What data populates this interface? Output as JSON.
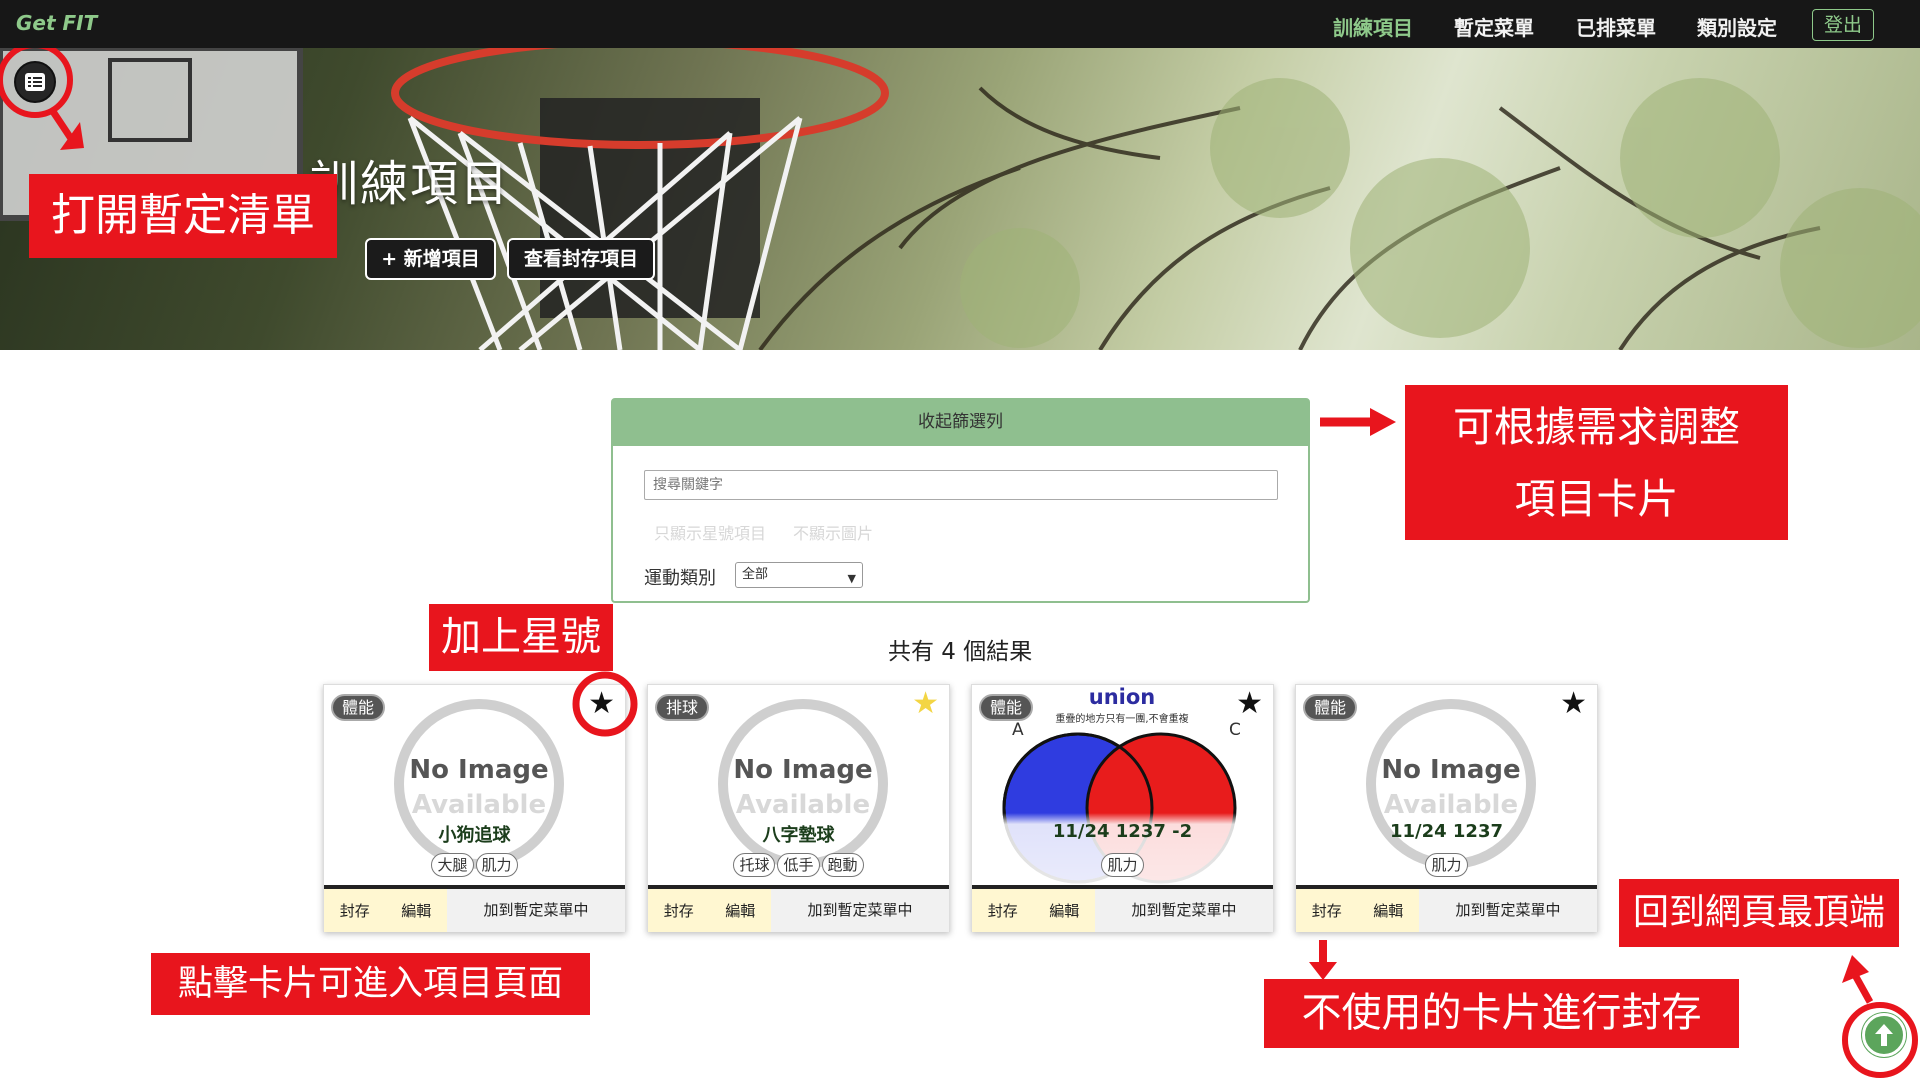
{
  "navbar": {
    "brand": "Get FIT",
    "links": [
      "訓練項目",
      "暫定菜單",
      "已排菜單",
      "類別設定"
    ],
    "logout": "登出"
  },
  "hero": {
    "title": "訓練項目",
    "add_button": "+ 新增項目",
    "archive_button": "查看封存項目"
  },
  "filter": {
    "header": "收起篩選列",
    "search_placeholder": "搜尋關鍵字",
    "option_starred": "只顯示星號項目",
    "option_no_image": "不顯示圖片",
    "category_label": "運動類別",
    "category_value": "全部"
  },
  "results": "共有 4 個結果",
  "cards": [
    {
      "badge": "體能",
      "title": "小狗追球",
      "tags": [
        "大腿",
        "肌力"
      ],
      "starred": true,
      "image_text_1": "No Image",
      "image_text_2": "Available"
    },
    {
      "badge": "排球",
      "title": "八字墊球",
      "tags": [
        "托球",
        "低手",
        "跑動"
      ],
      "starred": false,
      "image_text_1": "No Image",
      "image_text_2": "Available"
    },
    {
      "badge": "體能",
      "title": "11/24 1237 -2",
      "tags": [
        "肌力"
      ],
      "starred": true,
      "image_heading": "union",
      "image_caption": "重疊的地方只有一團,不會重複",
      "label_a": "A",
      "label_c": "C"
    },
    {
      "badge": "體能",
      "title": "11/24 1237",
      "tags": [
        "肌力"
      ],
      "starred": true,
      "image_text_1": "No Image",
      "image_text_2": "Available"
    }
  ],
  "card_actions": {
    "archive": "封存",
    "edit": "編輯",
    "add_to_menu": "加到暫定菜單中"
  },
  "annotations": {
    "open_list": "打開暫定清單",
    "adjust_cards_1": "可根據需求調整",
    "adjust_cards_2": "項目卡片",
    "add_star": "加上星號",
    "click_card": "點擊卡片可進入項目頁面",
    "archive_tip": "不使用的卡片進行封存",
    "back_to_top": "回到網頁最頂端"
  },
  "colors": {
    "accent_green": "#8ec98a",
    "panel_green": "#8fbf8f",
    "annotation_red": "#e8151d",
    "star_gold": "#f3d544"
  }
}
